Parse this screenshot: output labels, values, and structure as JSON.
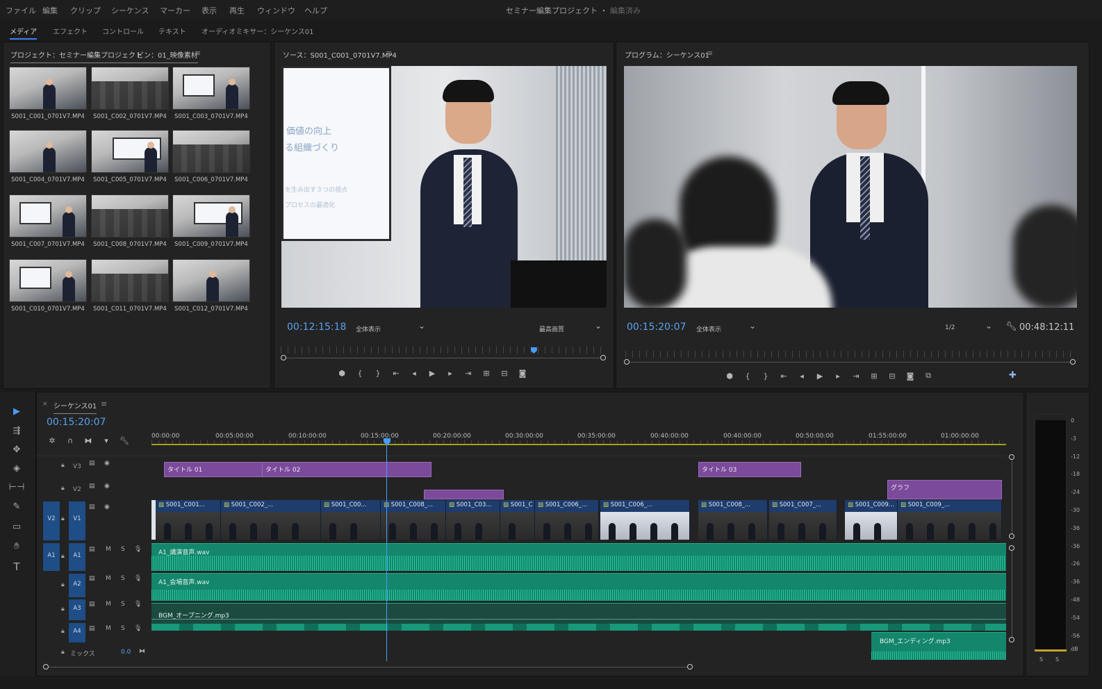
{
  "menu": [
    "ファイル",
    "編集",
    "クリップ",
    "シーケンス",
    "マーカー",
    "表示",
    "再生",
    "ウィンドウ",
    "ヘルプ"
  ],
  "app": {
    "title": "セミナー編集プロジェクト",
    "separator": "・",
    "status": "編集済み"
  },
  "workspaces": [
    "メディア",
    "エフェクト",
    "コントロール",
    "テキスト",
    "オーディオミキサー：シーケンス01"
  ],
  "project": {
    "tab": "プロジェクト：セミナー編集プロジェクト",
    "bin_tab": "ビン：01_映像素材",
    "clips": [
      "S001_C001_0701V7.MP4",
      "S001_C002_0701V7.MP4",
      "S001_C003_0701V7.MP4",
      "S001_C004_0701V7.MP4",
      "S001_C005_0701V7.MP4",
      "S001_C006_0701V7.MP4",
      "S001_C007_0701V7.MP4",
      "S001_C008_0701V7.MP4",
      "S001_C009_0701V7.MP4",
      "S001_C010_0701V7.MP4",
      "S001_C011_0701V7.MP4",
      "S001_C012_0701V7.MP4"
    ]
  },
  "source": {
    "tab": "ソース：S001_C001_0701V7.MP4",
    "slide_lines": [
      "価値の向上",
      "る組織づくり",
      "を生み出す３つの視点",
      "プロセスの最適化"
    ],
    "timecode": "00:12:15:18",
    "zoom": "全体表示",
    "quality": "最高画質",
    "playhead_fraction": 0.78
  },
  "program": {
    "tab": "プログラム：シーケンス01",
    "timecode": "00:15:20:07",
    "zoom": "全体表示",
    "resolution": "1/2",
    "duration": "00:48:12:11"
  },
  "timeline": {
    "tab": "シーケンス01",
    "timecode": "00:15:20:07",
    "ruler": [
      "00:00:00",
      "00:05:00:00",
      "00:10:00:00",
      "00:15:00:00",
      "00:20:00:00",
      "00:30:00:00",
      "00:35:00:00",
      "00:40:00:00",
      "00:40:00:00",
      "00:50:00:00",
      "01:55:00:00",
      "01:00:00:00"
    ],
    "tracks": {
      "v3": "V3",
      "v2": "V2",
      "v1": "V1",
      "src_v": "V2",
      "a1": "A1",
      "a2": "A2",
      "a3": "A3",
      "a4": "A4",
      "src_a": "A1",
      "mute": "M",
      "solo": "S"
    },
    "mix": {
      "label": "ミックス",
      "value": "0.0"
    },
    "titles": [
      "タイトル 01",
      "タイトル 02",
      "タイトル 03"
    ],
    "graph": "グラフ",
    "video_clips": [
      "S001_C001...",
      "S001_C002_...",
      "S001_C00...",
      "S001_C008_...",
      "S001_C03...",
      "S001_C...",
      "S001_C006_...",
      "S001_C006_...",
      "S001_C008_...",
      "S001_C007_...",
      "S001_C009...",
      "S001_C009_..."
    ],
    "audio_clips": [
      "A1_講演音声.wav",
      "A1_会場音声.wav",
      "BGM_オープニング.mp3",
      "BGM_エンディング.mp3"
    ]
  },
  "meter": {
    "scale": [
      "0",
      "-3",
      "-12",
      "-18",
      "-24",
      "-30",
      "-36",
      "-36",
      "-26",
      "-36",
      "-48",
      "-54",
      "-56"
    ],
    "unit": "dB",
    "solo": [
      "S",
      "S"
    ]
  }
}
